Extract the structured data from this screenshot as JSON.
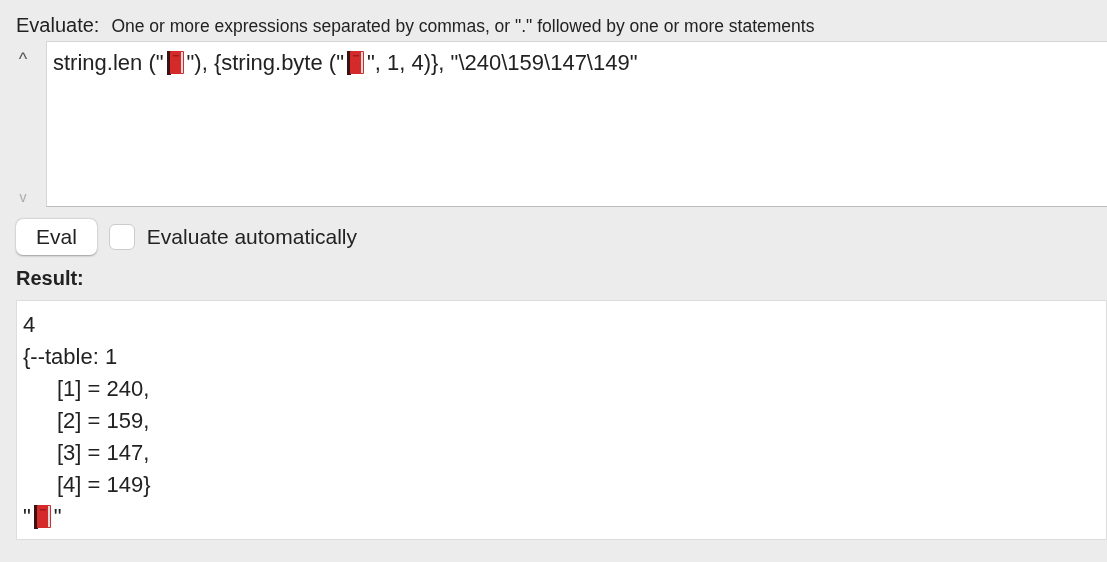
{
  "evaluate": {
    "label": "Evaluate:",
    "hint": "One or more expressions separated by commas, or \".\" followed by one or more statements",
    "expression": [
      {
        "kind": "text",
        "text": "string.len (\""
      },
      {
        "kind": "book"
      },
      {
        "kind": "text",
        "text": "\"), {string.byte (\""
      },
      {
        "kind": "book"
      },
      {
        "kind": "text",
        "text": "\", 1, 4)}, \"\\240\\159\\147\\149\""
      }
    ],
    "scroll_up": "^",
    "scroll_down": "v"
  },
  "eval_button": "Eval",
  "auto": {
    "label": "Evaluate automatically",
    "checked": false
  },
  "result": {
    "label": "Result:",
    "lines": [
      {
        "segments": [
          {
            "kind": "text",
            "text": "4"
          }
        ]
      },
      {
        "segments": [
          {
            "kind": "text",
            "text": "{--table: 1"
          }
        ],
        "children": [
          {
            "segments": [
              {
                "kind": "text",
                "text": "[1] = 240,"
              }
            ]
          },
          {
            "segments": [
              {
                "kind": "text",
                "text": "[2] = 159,"
              }
            ]
          },
          {
            "segments": [
              {
                "kind": "text",
                "text": "[3] = 147,"
              }
            ]
          },
          {
            "segments": [
              {
                "kind": "text",
                "text": "[4] = 149}"
              }
            ]
          }
        ]
      },
      {
        "segments": [
          {
            "kind": "text",
            "text": "\""
          },
          {
            "kind": "book"
          },
          {
            "kind": "text",
            "text": "\""
          }
        ]
      }
    ]
  }
}
